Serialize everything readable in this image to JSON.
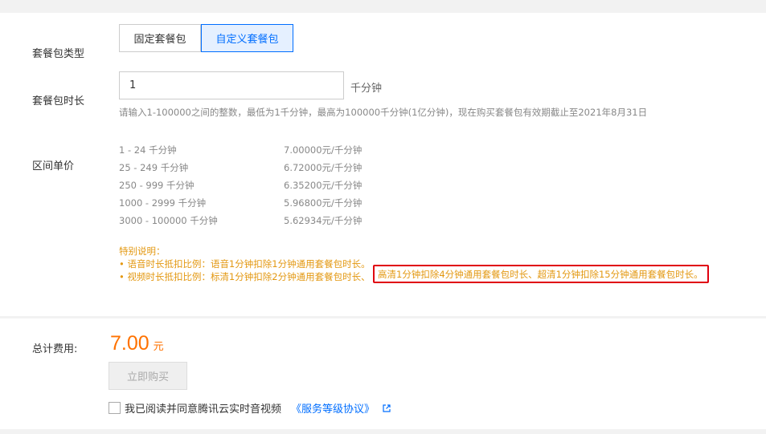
{
  "package_type": {
    "label": "套餐包类型",
    "options": [
      "固定套餐包",
      "自定义套餐包"
    ],
    "selected": "自定义套餐包"
  },
  "duration": {
    "label": "套餐包时长",
    "value": "1",
    "unit": "千分钟",
    "hint": "请输入1-100000之间的整数，最低为1千分钟，最高为100000千分钟(1亿分钟)，现在购买套餐包有效期截止至2021年8月31日"
  },
  "tier_pricing": {
    "label": "区间单价",
    "rows": [
      {
        "range": "1 - 24 千分钟",
        "price": "7.00000元/千分钟"
      },
      {
        "range": "25 - 249 千分钟",
        "price": "6.72000元/千分钟"
      },
      {
        "range": "250 - 999 千分钟",
        "price": "6.35200元/千分钟"
      },
      {
        "range": "1000 - 2999 千分钟",
        "price": "5.96800元/千分钟"
      },
      {
        "range": "3000 - 100000 千分钟",
        "price": "5.62934元/千分钟"
      }
    ]
  },
  "notes": {
    "title": "特别说明：",
    "line1": "• 语音时长抵扣比例：语音1分钟扣除1分钟通用套餐包时长。",
    "line2": "• 视频时长抵扣比例：标清1分钟扣除2分钟通用套餐包时长、",
    "highlighted": "高清1分钟扣除4分钟通用套餐包时长、超清1分钟扣除15分钟通用套餐包时长。"
  },
  "total": {
    "label": "总计费用:",
    "amount": "7.00",
    "unit": "元"
  },
  "buy_button": "立即购买",
  "agreement": {
    "text": "我已阅读并同意腾讯云实时音视频",
    "link": "《服务等级协议》"
  },
  "colors": {
    "accent": "#006eff",
    "price": "#ff7200",
    "note": "#e39811",
    "highlight_border": "#e0000f"
  }
}
